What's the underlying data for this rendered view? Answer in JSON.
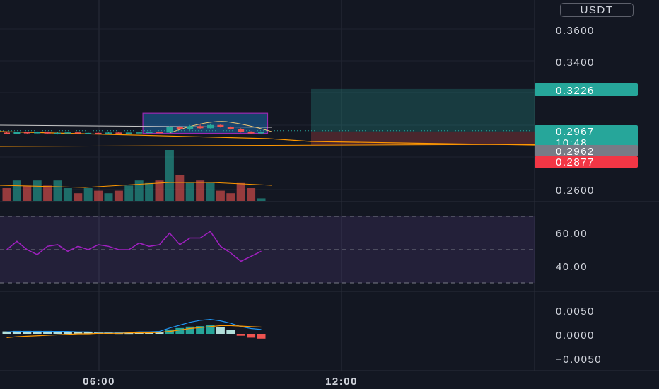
{
  "currency_label": "USDT",
  "colors": {
    "up": "#26a69a",
    "down": "#ef5350",
    "rsi": "#a020c0",
    "macd": "#2196f3",
    "signal": "#ff9800",
    "ma": "#f0c674"
  },
  "price_axis": {
    "ticks": [
      "0.3600",
      "0.3400",
      "0.2600"
    ]
  },
  "price_tags": [
    {
      "label": "0.3226",
      "color": "#26a69a",
      "name": "take-profit-tag"
    },
    {
      "label": "0.2967",
      "color": "#26a69a",
      "name": "current-price-tag"
    },
    {
      "label": "10:48",
      "color": "#26a69a",
      "name": "countdown-tag"
    },
    {
      "label": "0.2962",
      "color": "#787b86",
      "name": "ma-price-tag"
    },
    {
      "label": "0.2877",
      "color": "#f23645",
      "name": "stop-loss-tag"
    }
  ],
  "rsi_axis": {
    "ticks": [
      "60.00",
      "40.00"
    ]
  },
  "macd_axis": {
    "ticks": [
      "0.0050",
      "0.0000",
      "−0.0050"
    ]
  },
  "time_axis": {
    "ticks": [
      "06:00",
      "12:00"
    ]
  },
  "chart_data": {
    "type": "candlestick",
    "candles": [
      {
        "o": 0.2955,
        "c": 0.2948,
        "h": 0.2962,
        "l": 0.2944
      },
      {
        "o": 0.2948,
        "c": 0.2957,
        "h": 0.2961,
        "l": 0.2945
      },
      {
        "o": 0.2957,
        "c": 0.295,
        "h": 0.296,
        "l": 0.2946
      },
      {
        "o": 0.295,
        "c": 0.296,
        "h": 0.2963,
        "l": 0.2946
      },
      {
        "o": 0.296,
        "c": 0.2949,
        "h": 0.2962,
        "l": 0.2944
      },
      {
        "o": 0.2949,
        "c": 0.2953,
        "h": 0.2957,
        "l": 0.2943
      },
      {
        "o": 0.2953,
        "c": 0.2956,
        "h": 0.296,
        "l": 0.295
      },
      {
        "o": 0.2956,
        "c": 0.2951,
        "h": 0.2958,
        "l": 0.2948
      },
      {
        "o": 0.2951,
        "c": 0.2953,
        "h": 0.2956,
        "l": 0.2949
      },
      {
        "o": 0.2953,
        "c": 0.295,
        "h": 0.2955,
        "l": 0.2947
      },
      {
        "o": 0.295,
        "c": 0.2955,
        "h": 0.2958,
        "l": 0.2948
      },
      {
        "o": 0.2955,
        "c": 0.2952,
        "h": 0.2957,
        "l": 0.295
      },
      {
        "o": 0.2952,
        "c": 0.2955,
        "h": 0.2957,
        "l": 0.295
      },
      {
        "o": 0.2955,
        "c": 0.2956,
        "h": 0.2958,
        "l": 0.2953
      },
      {
        "o": 0.2956,
        "c": 0.2958,
        "h": 0.2961,
        "l": 0.2954
      },
      {
        "o": 0.2958,
        "c": 0.2955,
        "h": 0.296,
        "l": 0.2952
      },
      {
        "o": 0.2955,
        "c": 0.299,
        "h": 0.2996,
        "l": 0.2954
      },
      {
        "o": 0.299,
        "c": 0.2975,
        "h": 0.2998,
        "l": 0.2968
      },
      {
        "o": 0.2975,
        "c": 0.2995,
        "h": 0.3002,
        "l": 0.297
      },
      {
        "o": 0.2995,
        "c": 0.2982,
        "h": 0.3006,
        "l": 0.2978
      },
      {
        "o": 0.2982,
        "c": 0.3002,
        "h": 0.301,
        "l": 0.298
      },
      {
        "o": 0.3002,
        "c": 0.299,
        "h": 0.3008,
        "l": 0.2986
      },
      {
        "o": 0.299,
        "c": 0.2978,
        "h": 0.2996,
        "l": 0.2972
      },
      {
        "o": 0.2978,
        "c": 0.296,
        "h": 0.2982,
        "l": 0.2955
      },
      {
        "o": 0.296,
        "c": 0.295,
        "h": 0.2964,
        "l": 0.2945
      },
      {
        "o": 0.295,
        "c": 0.2957,
        "h": 0.2962,
        "l": 0.2948
      }
    ],
    "volume": [
      0.25,
      0.4,
      0.3,
      0.4,
      0.3,
      0.4,
      0.25,
      0.15,
      0.25,
      0.2,
      0.15,
      0.2,
      0.3,
      0.4,
      0.35,
      0.4,
      1.0,
      0.5,
      0.35,
      0.4,
      0.35,
      0.2,
      0.15,
      0.35,
      0.25,
      0.05
    ],
    "rsi": [
      50,
      55,
      50,
      47,
      52,
      53,
      49,
      52,
      50,
      53,
      52,
      50,
      50,
      54,
      52,
      53,
      60,
      53,
      57,
      57,
      61,
      52,
      48,
      43,
      46,
      49
    ],
    "macd_hist": [
      0.0005,
      0.0006,
      0.0006,
      0.0006,
      0.0006,
      0.0005,
      0.0005,
      0.0004,
      0.0004,
      0.0003,
      0.0003,
      0.0002,
      0.0002,
      0.0003,
      0.0003,
      0.0004,
      0.0009,
      0.0012,
      0.0015,
      0.0016,
      0.0018,
      0.0014,
      0.0008,
      -0.0004,
      -0.0008,
      -0.001
    ],
    "macd_line": [
      0.0004,
      0.0005,
      0.0005,
      0.0005,
      0.0005,
      0.0005,
      0.0005,
      0.0004,
      0.0004,
      0.0003,
      0.0003,
      0.0003,
      0.0003,
      0.0004,
      0.0004,
      0.0005,
      0.0012,
      0.0018,
      0.0024,
      0.0028,
      0.003,
      0.0027,
      0.0022,
      0.0015,
      0.0011,
      0.0009
    ],
    "signal_line": [
      -0.0008,
      -0.0006,
      -0.0005,
      -0.0004,
      -0.0003,
      -0.0002,
      -0.0001,
      0.0,
      0.0,
      0.0001,
      0.0001,
      0.0001,
      0.0002,
      0.0002,
      0.0002,
      0.0003,
      0.0005,
      0.0008,
      0.0011,
      0.0013,
      0.0015,
      0.0017,
      0.0017,
      0.0016,
      0.0015,
      0.0014
    ],
    "ylim": [
      0.255,
      0.375
    ],
    "rsi_range": [
      30,
      70
    ],
    "position": {
      "entry": 0.2962,
      "take_profit": 0.3226,
      "stop_loss": 0.2877
    }
  }
}
